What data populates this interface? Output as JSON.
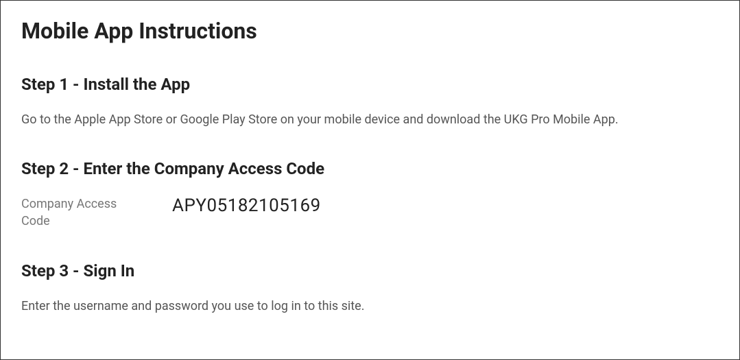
{
  "title": "Mobile App Instructions",
  "steps": {
    "step1": {
      "heading": "Step 1 - Install the App",
      "description": "Go to the Apple App Store or Google Play Store on your mobile device and download the UKG Pro Mobile App."
    },
    "step2": {
      "heading": "Step 2 - Enter the Company Access Code",
      "codeLabel": "Company Access Code",
      "codeValue": "APY05182105169"
    },
    "step3": {
      "heading": "Step 3 - Sign In",
      "description": "Enter the username and password you use to log in to this site."
    }
  }
}
